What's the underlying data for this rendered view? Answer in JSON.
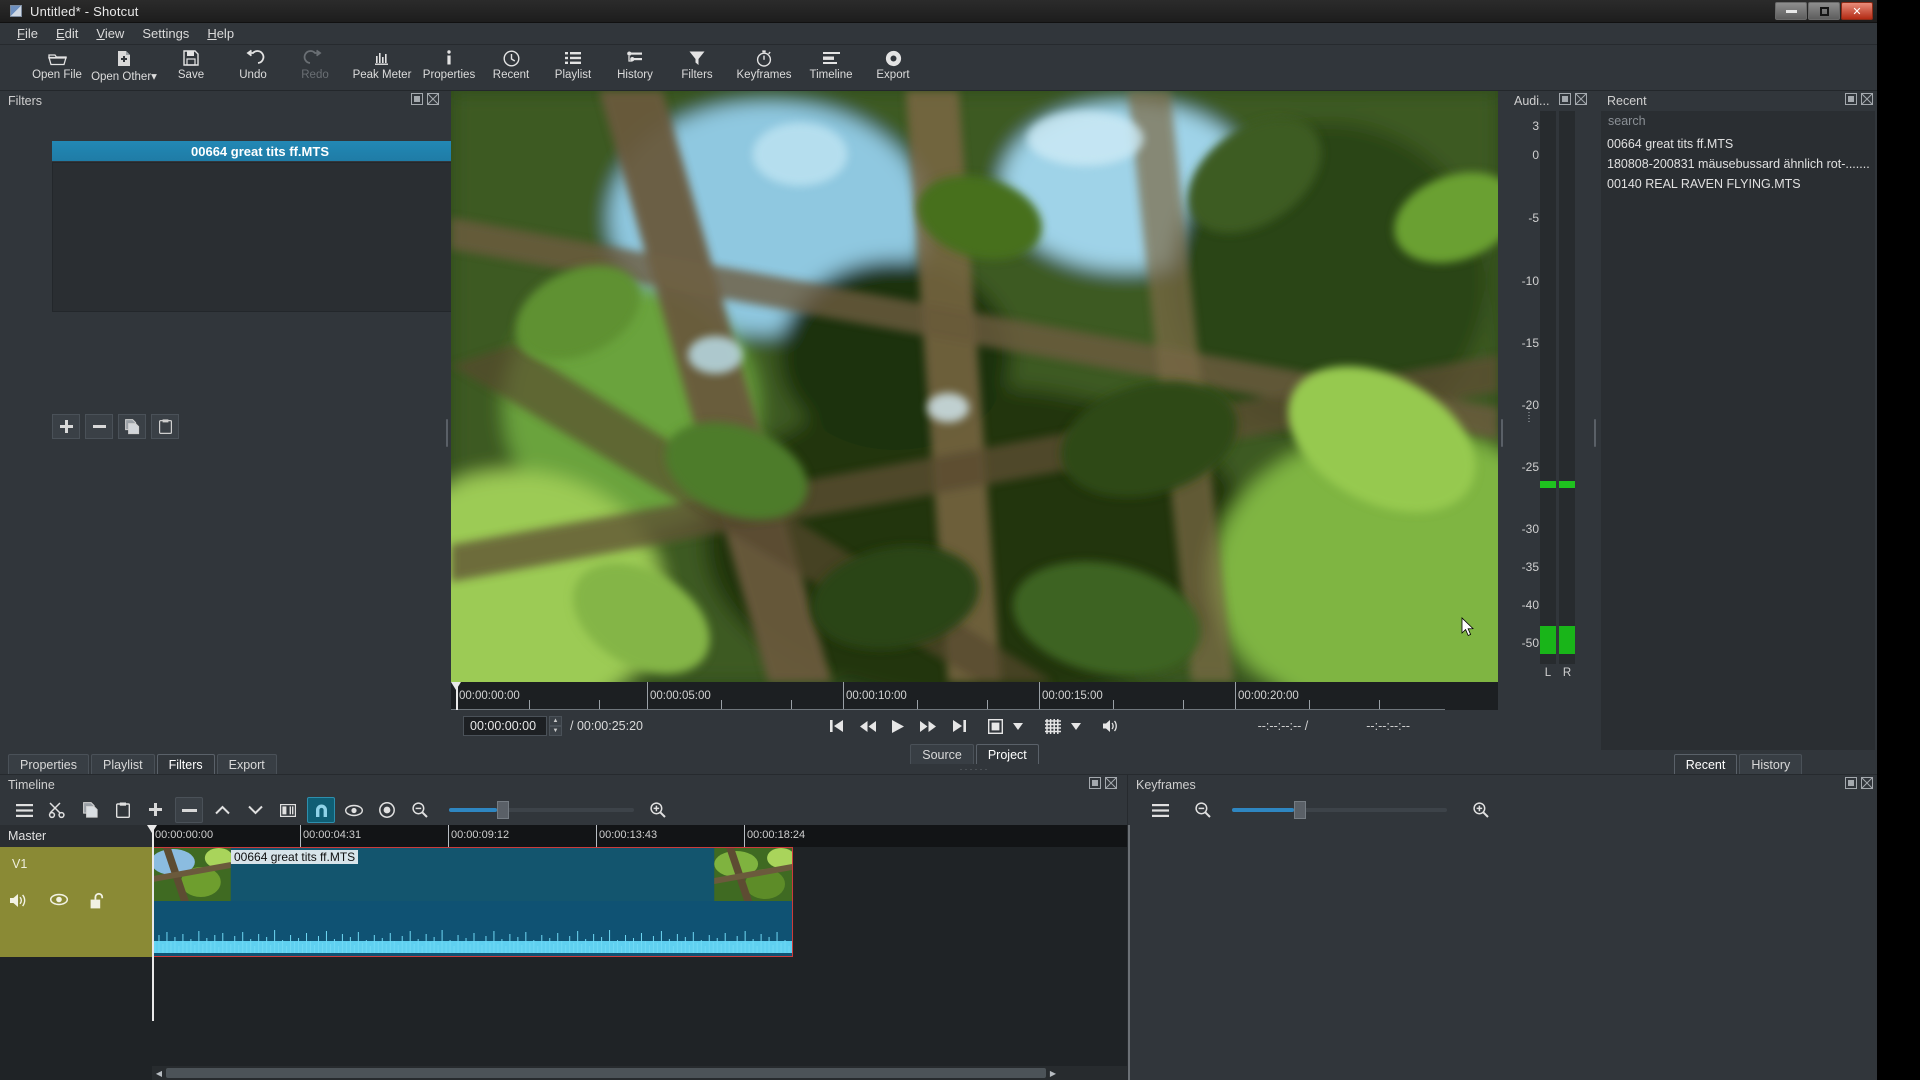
{
  "window": {
    "title": "Untitled* - Shotcut",
    "app_icon": "shotcut-icon",
    "minimize_label": "Minimize",
    "maximize_label": "Restore",
    "close_label": "Close"
  },
  "menubar": {
    "items": [
      {
        "label": "File",
        "mnemonic": "F"
      },
      {
        "label": "Edit",
        "mnemonic": "E"
      },
      {
        "label": "View",
        "mnemonic": "V"
      },
      {
        "label": "Settings",
        "mnemonic": "S"
      },
      {
        "label": "Help",
        "mnemonic": "H"
      }
    ]
  },
  "toolbar": {
    "buttons": [
      {
        "label": "Open File",
        "icon": "folder-open-icon",
        "disabled": false
      },
      {
        "label": "Open Other",
        "icon": "open-other-icon",
        "disabled": false
      },
      {
        "label": "Save",
        "icon": "floppy-save-icon",
        "disabled": false
      },
      {
        "label": "Undo",
        "icon": "undo-arrow-icon",
        "disabled": false
      },
      {
        "label": "Redo",
        "icon": "redo-arrow-icon",
        "disabled": true
      },
      {
        "label": "Peak Meter",
        "icon": "peak-meter-icon",
        "disabled": false
      },
      {
        "label": "Properties",
        "icon": "info-icon",
        "disabled": false
      },
      {
        "label": "Recent",
        "icon": "clock-icon",
        "disabled": false
      },
      {
        "label": "Playlist",
        "icon": "list-icon",
        "disabled": false
      },
      {
        "label": "History",
        "icon": "history-icon",
        "disabled": false
      },
      {
        "label": "Filters",
        "icon": "funnel-icon",
        "disabled": false
      },
      {
        "label": "Keyframes",
        "icon": "stopwatch-icon",
        "disabled": false
      },
      {
        "label": "Timeline",
        "icon": "timeline-icon",
        "disabled": false
      },
      {
        "label": "Export",
        "icon": "export-icon",
        "disabled": false
      }
    ]
  },
  "filters_panel": {
    "title": "Filters",
    "selected_clip": "00664 great tits ff.MTS",
    "actions": [
      {
        "name": "add-filter",
        "icon": "plus-icon"
      },
      {
        "name": "remove-filter",
        "icon": "minus-icon"
      },
      {
        "name": "copy-filters",
        "icon": "copy-icon"
      },
      {
        "name": "paste-filters",
        "icon": "paste-icon"
      }
    ],
    "empty_list_text": ""
  },
  "left_tabs": {
    "items": [
      {
        "label": "Properties",
        "active": false
      },
      {
        "label": "Playlist",
        "active": false
      },
      {
        "label": "Filters",
        "active": true
      },
      {
        "label": "Export",
        "active": false
      }
    ]
  },
  "player": {
    "position": "00:00:00:00",
    "duration": "00:00:25:20",
    "duration_prefix": "/",
    "in_point": "--:--:--:--",
    "out_point": "--:--:--:--",
    "selected_duration_separator": "/",
    "scrub_ticks": [
      "00:00:00:00",
      "00:00:05:00",
      "00:00:10:00",
      "00:00:15:00",
      "00:00:20:00"
    ],
    "transport": [
      {
        "name": "skip-to-start-button",
        "icon": "skip-previous-icon"
      },
      {
        "name": "rewind-button",
        "icon": "rewind-icon"
      },
      {
        "name": "play-button",
        "icon": "play-icon"
      },
      {
        "name": "fast-forward-button",
        "icon": "fast-forward-icon"
      },
      {
        "name": "skip-to-end-button",
        "icon": "skip-next-icon"
      },
      {
        "name": "toggle-zoom-button",
        "icon": "zoom-fit-icon"
      },
      {
        "name": "zoom-menu-button",
        "icon": "chevron-down-icon"
      },
      {
        "name": "grid-button",
        "icon": "grid-icon"
      },
      {
        "name": "grid-menu-button",
        "icon": "chevron-down-icon"
      },
      {
        "name": "volume-button",
        "icon": "speaker-icon"
      }
    ],
    "tabs": [
      {
        "label": "Source",
        "active": false
      },
      {
        "label": "Project",
        "active": true
      }
    ]
  },
  "audio_meter": {
    "title": "Audi...",
    "scale": [
      "3",
      "0",
      "-5",
      "-10",
      "-15",
      "-20",
      "-25",
      "-30",
      "-35",
      "-40",
      "-50"
    ],
    "channels": [
      "L",
      "R"
    ],
    "peak_color": "#1fc21f",
    "level_color": "#19b519"
  },
  "recent_panel": {
    "title": "Recent",
    "search_placeholder": "search",
    "items": [
      "00664 great tits ff.MTS",
      "180808-200831 mäusebussard ähnlich rot-.......",
      "00140 REAL RAVEN FLYING.MTS"
    ],
    "tabs": [
      {
        "label": "Recent",
        "active": true
      },
      {
        "label": "History",
        "active": false
      }
    ]
  },
  "timeline": {
    "title": "Timeline",
    "toolbar": [
      {
        "name": "timeline-menu-button",
        "icon": "hamburger-icon",
        "active": false
      },
      {
        "name": "cut-button",
        "icon": "scissors-icon",
        "active": false
      },
      {
        "name": "copy-button",
        "icon": "copy-icon",
        "active": false
      },
      {
        "name": "paste-button",
        "icon": "clipboard-icon",
        "active": false
      },
      {
        "name": "append-button",
        "icon": "plus-icon",
        "active": false
      },
      {
        "name": "ripple-delete-button",
        "icon": "minus-icon",
        "active": false
      },
      {
        "name": "lift-button",
        "icon": "chevron-up-icon",
        "active": false
      },
      {
        "name": "overwrite-button",
        "icon": "chevron-down-icon",
        "active": false
      },
      {
        "name": "split-button",
        "icon": "split-icon",
        "active": false
      },
      {
        "name": "snap-button",
        "icon": "magnet-icon",
        "active": true
      },
      {
        "name": "scrub-while-dragging-button",
        "icon": "eye-icon",
        "active": false
      },
      {
        "name": "ripple-button",
        "icon": "target-icon",
        "active": false
      },
      {
        "name": "zoom-out-button",
        "icon": "zoom-out-icon",
        "active": false
      },
      {
        "name": "zoom-in-button",
        "icon": "zoom-in-icon",
        "active": false
      }
    ],
    "master_label": "Master",
    "track": {
      "name": "V1",
      "mute_icon": "speaker-icon",
      "hide_icon": "eye-icon",
      "lock_icon": "unlocked-padlock-icon"
    },
    "ruler_marks": [
      "00:00:00:00",
      "00:00:04:31",
      "00:00:09:12",
      "00:00:13:43",
      "00:00:18:24"
    ],
    "clip": {
      "label": "00664 great tits ff.MTS",
      "body_color": "#13556e",
      "border_color": "#cc3b3b"
    },
    "zoom_value": 26
  },
  "keyframes": {
    "title": "Keyframes",
    "toolbar": [
      {
        "name": "keyframes-menu-button",
        "icon": "hamburger-icon"
      },
      {
        "name": "keyframes-zoom-out-button",
        "icon": "zoom-out-icon"
      },
      {
        "name": "keyframes-zoom-in-button",
        "icon": "zoom-in-icon"
      }
    ],
    "zoom_value": 28
  },
  "colors": {
    "panel_bg": "#31363b",
    "accent_blue": "#2288b5",
    "track_head": "#8a8a35",
    "clip_blue": "#13556e"
  }
}
